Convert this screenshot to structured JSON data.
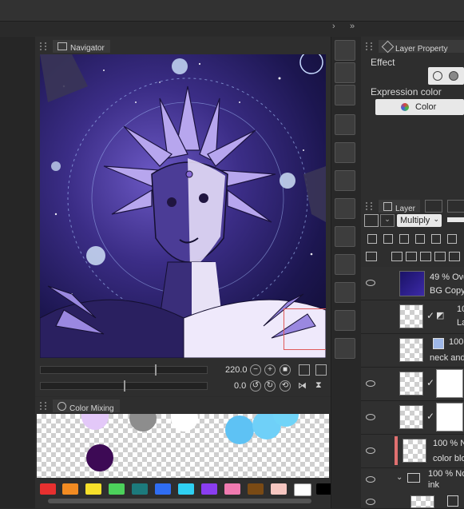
{
  "navigator": {
    "title": "Navigator",
    "zoom": "220.0",
    "rotation": "0.0"
  },
  "color_mixing": {
    "title": "Color Mixing",
    "palette": [
      "#e8302f",
      "#f28b22",
      "#f6e02a",
      "#4cd15b",
      "#1c7a7c",
      "#2f6df2",
      "#2fd0f2",
      "#8a3df0",
      "#f07ab0",
      "#7a4a14",
      "#f6c6c0",
      "#ffffff",
      "#000000"
    ]
  },
  "layer_property": {
    "title": "Layer Property",
    "effect_label": "Effect",
    "expression_label": "Expression color",
    "expression_value": "Color"
  },
  "layer_panel": {
    "title": "Layer",
    "blend_mode": "Multiply",
    "layers": [
      {
        "opacity": "49 % Ove",
        "name": "BG Copy"
      },
      {
        "opacity": "10",
        "name": "La"
      },
      {
        "opacity": "100",
        "name": "neck and"
      },
      {
        "opacity": "",
        "name": ""
      },
      {
        "opacity": "",
        "name": ""
      },
      {
        "opacity": "100 % N",
        "name": "color blo"
      },
      {
        "opacity": "100 % No",
        "name": "ink"
      }
    ]
  },
  "colors": {
    "panel_bg": "#2e2e2e",
    "accent_selection": "#e05a5a"
  }
}
